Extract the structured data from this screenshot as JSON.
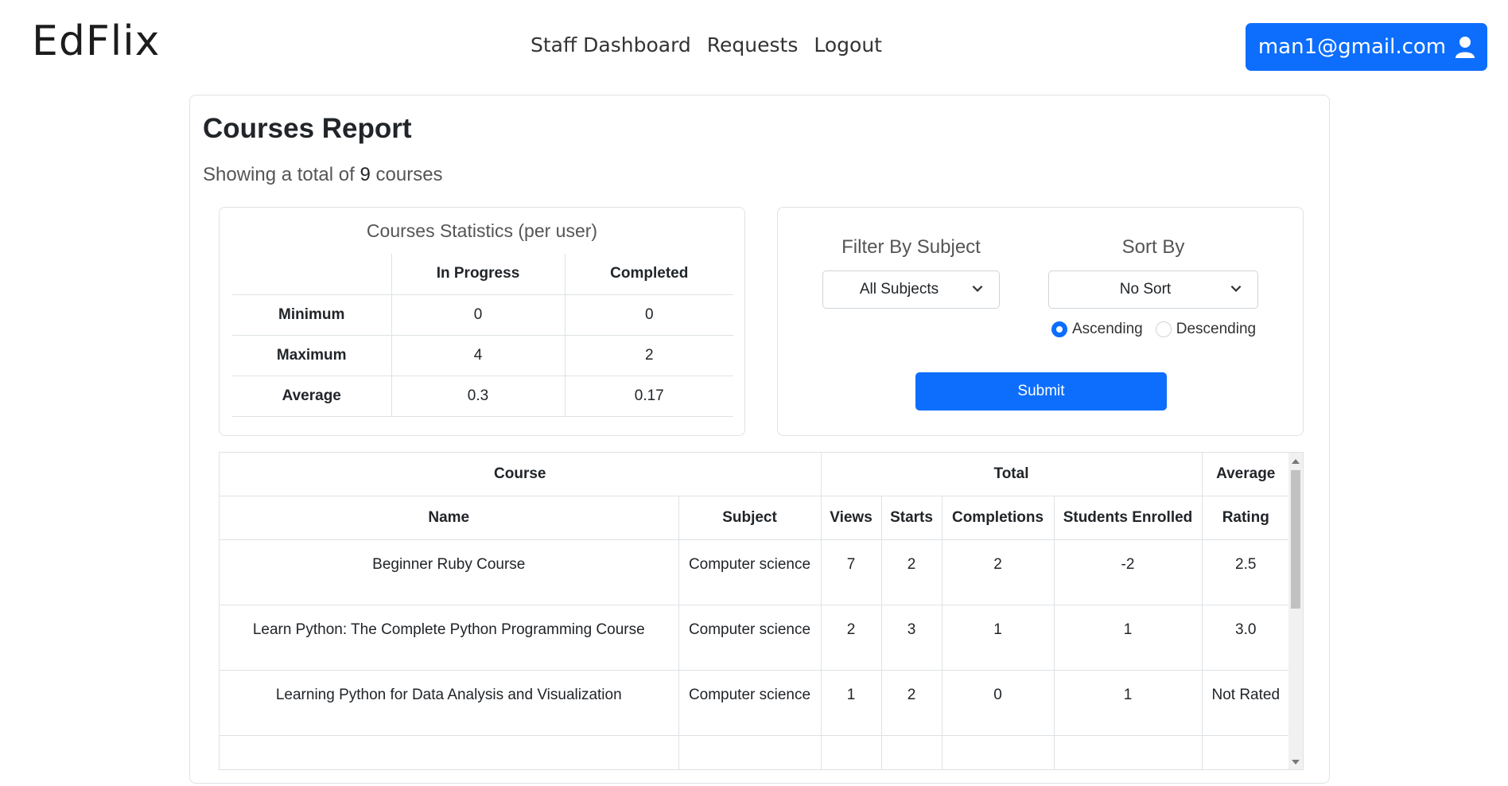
{
  "nav": {
    "brand": "EdFlix",
    "links": [
      "Staff Dashboard",
      "Requests",
      "Logout"
    ],
    "user_email": "man1@gmail.com"
  },
  "report": {
    "title": "Courses Report",
    "subtitle_prefix": "Showing a total of",
    "total": "9",
    "subtitle_suffix": "courses"
  },
  "stats": {
    "title": "Courses Statistics (per user)",
    "headers": [
      "",
      "In Progress",
      "Completed"
    ],
    "rows": [
      {
        "label": "Minimum",
        "in_progress": "0",
        "completed": "0"
      },
      {
        "label": "Maximum",
        "in_progress": "4",
        "completed": "2"
      },
      {
        "label": "Average",
        "in_progress": "0.3",
        "completed": "0.17"
      }
    ]
  },
  "filters": {
    "subject_label": "Filter By Subject",
    "subject_value": "All Subjects",
    "sort_label": "Sort By",
    "sort_value": "No Sort",
    "ascending": "Ascending",
    "descending": "Descending",
    "submit": "Submit"
  },
  "table": {
    "group_headers": [
      "Course",
      "Total",
      "Average"
    ],
    "headers": [
      "Name",
      "Subject",
      "Views",
      "Starts",
      "Completions",
      "Students Enrolled",
      "Rating"
    ],
    "rows": [
      {
        "name": "Beginner Ruby Course",
        "subject": "Computer science",
        "views": "7",
        "starts": "2",
        "completions": "2",
        "enrolled": "-2",
        "rating": "2.5"
      },
      {
        "name": "Learn Python: The Complete Python Programming Course",
        "subject": "Computer science",
        "views": "2",
        "starts": "3",
        "completions": "1",
        "enrolled": "1",
        "rating": "3.0"
      },
      {
        "name": "Learning Python for Data Analysis and Visualization",
        "subject": "Computer science",
        "views": "1",
        "starts": "2",
        "completions": "0",
        "enrolled": "1",
        "rating": "Not Rated"
      }
    ]
  },
  "colors": {
    "primary": "#0d6efd",
    "border": "#dee2e6"
  }
}
